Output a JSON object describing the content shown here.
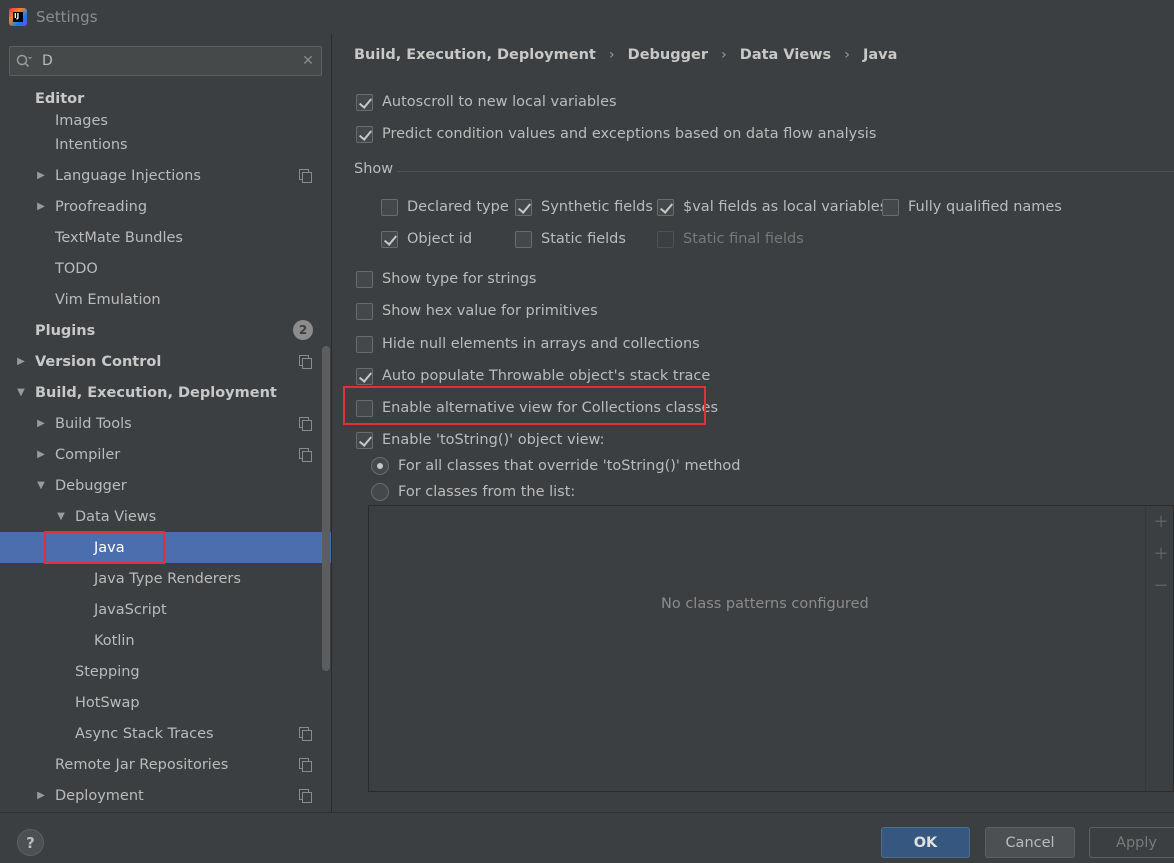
{
  "window": {
    "title": "Settings",
    "app_icon_text": "IJ"
  },
  "search": {
    "value": "D",
    "icon": "search-icon",
    "clear_icon": "close-icon"
  },
  "tree": {
    "editor_header": "Editor",
    "items": [
      {
        "label": "Images"
      },
      {
        "label": "Intentions"
      },
      {
        "label": "Language Injections"
      },
      {
        "label": "Proofreading"
      },
      {
        "label": "TextMate Bundles"
      },
      {
        "label": "TODO"
      },
      {
        "label": "Vim Emulation"
      },
      {
        "label": "Plugins",
        "badge": "2"
      },
      {
        "label": "Version Control"
      },
      {
        "label": "Build, Execution, Deployment"
      },
      {
        "label": "Build Tools"
      },
      {
        "label": "Compiler"
      },
      {
        "label": "Debugger"
      },
      {
        "label": "Data Views"
      },
      {
        "label": "Java"
      },
      {
        "label": "Java Type Renderers"
      },
      {
        "label": "JavaScript"
      },
      {
        "label": "Kotlin"
      },
      {
        "label": "Stepping"
      },
      {
        "label": "HotSwap"
      },
      {
        "label": "Async Stack Traces"
      },
      {
        "label": "Remote Jar Repositories"
      },
      {
        "label": "Deployment"
      }
    ]
  },
  "breadcrumb": [
    "Build, Execution, Deployment",
    "Debugger",
    "Data Views",
    "Java"
  ],
  "breadcrumb_sep": "›",
  "options": {
    "autoscroll": "Autoscroll to new local variables",
    "predict": "Predict condition values and exceptions based on data flow analysis",
    "show_group": "Show",
    "declared_type": "Declared type",
    "synthetic_fields": "Synthetic fields",
    "val_fields": "$val fields as local variables",
    "fully_qualified": "Fully qualified names",
    "object_id": "Object id",
    "static_fields": "Static fields",
    "static_final_fields": "Static final fields",
    "show_type_strings": "Show type for strings",
    "show_hex": "Show hex value for primitives",
    "hide_null": "Hide null elements in arrays and collections",
    "auto_populate": "Auto populate Throwable object's stack trace",
    "alt_view": "Enable alternative view for Collections classes",
    "tostring_view": "Enable 'toString()' object view:",
    "radio_all": "For all classes that override 'toString()' method",
    "radio_list": "For classes from the list:",
    "list_empty": "No class patterns configured"
  },
  "footer": {
    "help": "?",
    "ok": "OK",
    "cancel": "Cancel",
    "apply": "Apply"
  },
  "colors": {
    "selection": "#4b6eaf",
    "highlight": "#e0303a",
    "ok_button": "#365880"
  }
}
